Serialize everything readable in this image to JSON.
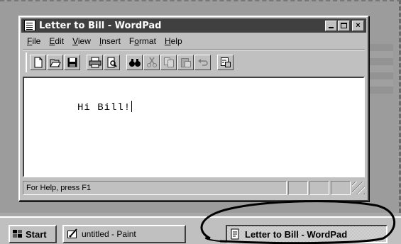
{
  "window": {
    "title": "Letter to Bill - WordPad",
    "controls": {
      "minimize": "_",
      "maximize": "□",
      "close": "×"
    }
  },
  "menu": {
    "items": [
      {
        "label": "File",
        "accel": "F",
        "rest": "ile"
      },
      {
        "label": "Edit",
        "accel": "E",
        "rest": "dit"
      },
      {
        "label": "View",
        "accel": "V",
        "rest": "iew"
      },
      {
        "label": "Insert",
        "accel": "I",
        "rest": "nsert"
      },
      {
        "label": "Format",
        "accel": "o",
        "pre": "F",
        "rest": "rmat"
      },
      {
        "label": "Help",
        "accel": "H",
        "rest": "elp"
      }
    ]
  },
  "toolbar": {
    "buttons": [
      "new-icon",
      "open-icon",
      "save-icon",
      "print-icon",
      "print-preview-icon",
      "find-icon",
      "cut-icon",
      "copy-icon",
      "paste-icon",
      "undo-icon",
      "date-time-icon"
    ]
  },
  "document": {
    "text": "Hi Bill!"
  },
  "status": {
    "text": "For Help, press F1"
  },
  "taskbar": {
    "start_label": "Start",
    "tasks": [
      {
        "label": "untitled - Paint",
        "active": false
      },
      {
        "label": "Letter to Bill - WordPad",
        "active": true
      }
    ]
  },
  "colors": {
    "face": "#c0c0c0",
    "titlebar": "#404040",
    "desktop": "#9c9c9c"
  }
}
